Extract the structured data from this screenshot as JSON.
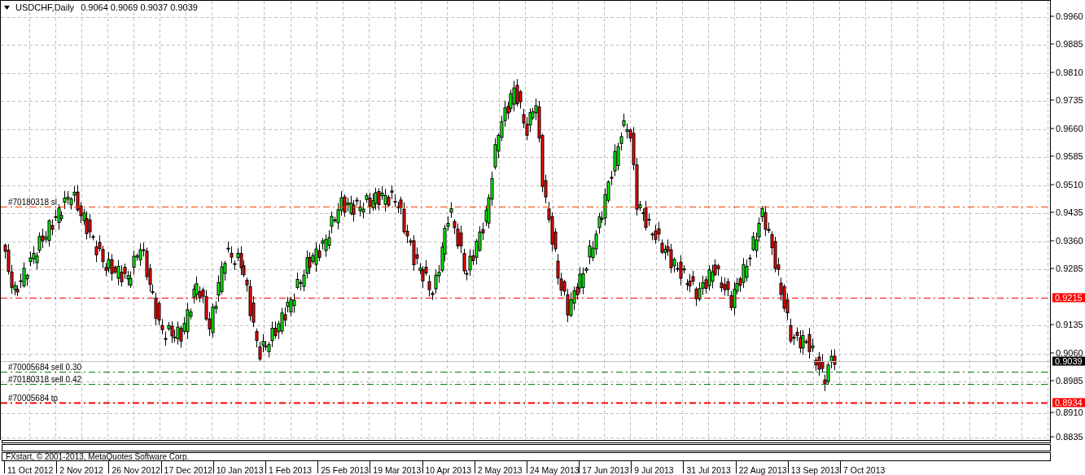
{
  "chart": {
    "symbol": "USDCHF,Daily",
    "ohlc": "0.9064 0.9069 0.9037 0.9039",
    "price_axis": [
      "0.9960",
      "0.9885",
      "0.9810",
      "0.9735",
      "0.9660",
      "0.9585",
      "0.9510",
      "0.9435",
      "0.9360",
      "0.9285",
      "0.9135",
      "0.9060",
      "0.8985",
      "0.8910",
      "0.8835"
    ],
    "order_lines": [
      {
        "kind": "stop_loss",
        "label": "#70180318 sl"
      },
      {
        "kind": "level",
        "tag": "0.9215"
      },
      {
        "kind": "bid",
        "tag": "0.9039"
      },
      {
        "kind": "entry",
        "label": "#70005684 sell 0.30"
      },
      {
        "kind": "entry",
        "label": "#70180318 sell 0.42"
      },
      {
        "kind": "take_profit",
        "label": "#70005684 tp",
        "tag": "0.8934"
      }
    ],
    "footer_caption": "FXstart, © 2001-2013, MetaQuotes Software Corp.",
    "time_axis": [
      "11 Oct 2012",
      "2 Nov 2012",
      "26 Nov 2012",
      "17 Dec 2012",
      "10 Jan 2013",
      "1 Feb 2013",
      "25 Feb 2013",
      "19 Mar 2013",
      "10 Apr 2013",
      "2 May 2013",
      "24 May 2013",
      "17 Jun 2013",
      "9 Jul 2013",
      "31 Jul 2013",
      "22 Aug 2013",
      "13 Sep 2013",
      "7 Oct 2013"
    ]
  }
}
